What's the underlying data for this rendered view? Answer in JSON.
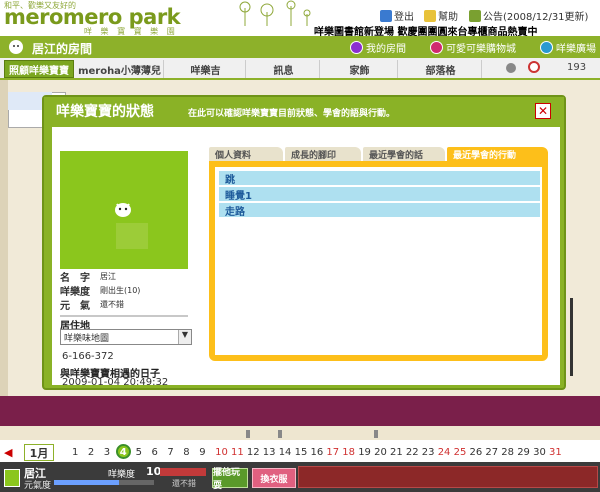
{
  "header": {
    "tagline": "和平、歡樂又友好的",
    "logo": "meromero park",
    "logo_sub": "咩 樂 寶 寶 樂 園",
    "links": [
      {
        "label": "登出",
        "icon": "logout-icon"
      },
      {
        "label": "幫助",
        "icon": "help-icon"
      },
      {
        "label": "公告(2008/12/31更新)",
        "icon": "announcement-icon"
      }
    ],
    "banner": "咩樂圖書館新登場 歡慶團團圓來台專櫃商品熱賣中"
  },
  "room_bar": {
    "title": "居江的房間",
    "links": [
      {
        "label": "我的房間",
        "icon": "my-room-icon",
        "color": "#8b2fd0"
      },
      {
        "label": "可愛可樂購物城",
        "icon": "shopping-icon",
        "color": "#d02a6f"
      },
      {
        "label": "咩樂廣場",
        "icon": "plaza-icon",
        "color": "#2a9ad0"
      }
    ]
  },
  "nav": {
    "tabs": [
      "照顧咩樂寶寶",
      "meroha小薄薄兒",
      "咩樂吉",
      "訊息",
      "家飾",
      "部落格"
    ],
    "count": "193"
  },
  "modal": {
    "title": "咩樂寶寶的狀態",
    "description": "在此可以確認咩樂寶寶目前狀態、學會的語與行動。",
    "close_label": "✕",
    "profile": {
      "rows": [
        {
          "key": "名　字",
          "value": "居江"
        },
        {
          "key": "咩樂度",
          "value": "剛出生(10)"
        },
        {
          "key": "元　氣",
          "value": "還不錯"
        }
      ],
      "location_label": "居住地",
      "location_value": "咩樂味地圖",
      "location_code": "6-166-372",
      "meet_label": "與咩樂寶寶相遇的日子",
      "meet_date": "2009-01-04 20:49:32"
    },
    "tabs": [
      "個人資料",
      "成長的腳印",
      "最近學會的話",
      "最近學會的行動"
    ],
    "active_tab": 3,
    "actions": [
      "跳",
      "睡覺1",
      "走路"
    ]
  },
  "day_bar": {
    "month": "1月",
    "days": [
      "1",
      "2",
      "3",
      "4",
      "5",
      "6",
      "7",
      "8",
      "9",
      "10",
      "11",
      "12",
      "13",
      "14",
      "15",
      "16",
      "17",
      "18",
      "19",
      "20",
      "21",
      "22",
      "23",
      "24",
      "25",
      "26",
      "27",
      "28",
      "29",
      "30",
      "31"
    ],
    "current_day": "4",
    "red_days": [
      "10",
      "11",
      "17",
      "18",
      "24",
      "25",
      "31"
    ]
  },
  "status_bar": {
    "name": "居江",
    "energy_label": "元氣度",
    "energy_level": 0.65,
    "level_label": "咩樂度",
    "level": "10",
    "status": "還不錯",
    "button_1": "擺他玩耍",
    "button_2": "換衣服"
  },
  "colors": {
    "brand_green": "#8db12a",
    "tab_gold": "#fdbf1a",
    "list_blue": "#aee0f0",
    "floor": "#7a1f4a"
  }
}
